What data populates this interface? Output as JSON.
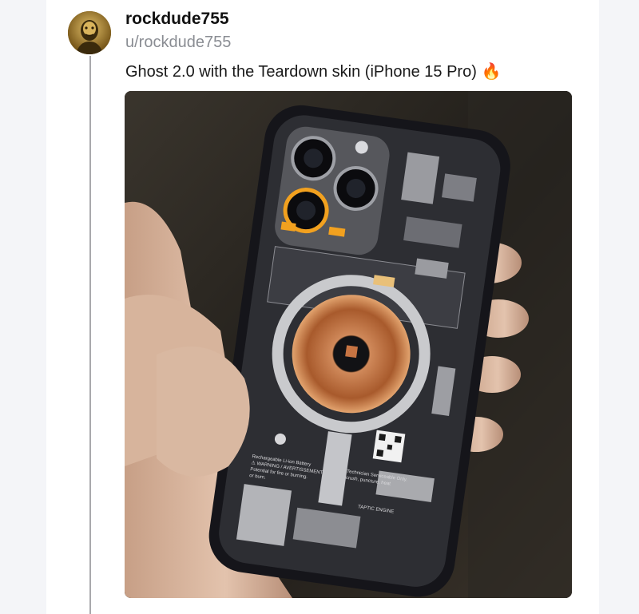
{
  "post": {
    "username": "rockdude755",
    "handle": "u/rockdude755",
    "text": "Ghost 2.0 with the Teardown skin (iPhone 15 Pro)",
    "emoji": "🔥",
    "avatar_icon": "user-avatar-icon"
  },
  "photo": {
    "label_lines": [
      "Rechargeable Li-ion Battery",
      "⚠ WARNING / AVERTISSEMENT",
      "Potential for fire or burning.",
      "or burn."
    ],
    "service_text_lines": [
      "Technician Serviceable Only.",
      "crush, puncture, heat"
    ],
    "taptic_label": "TAPTIC ENGINE"
  },
  "colors": {
    "accent_orange": "#f2a11f",
    "coil_copper": "#c77443",
    "card_bg": "#ffffff",
    "page_bg": "#f4f5f8"
  }
}
